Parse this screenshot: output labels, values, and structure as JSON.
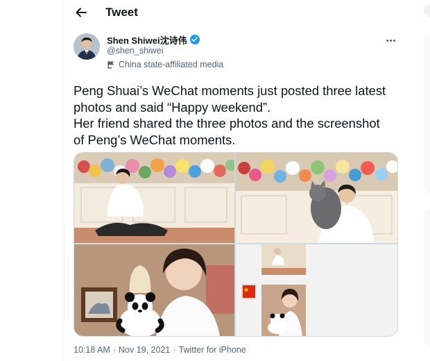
{
  "header": {
    "title": "Tweet",
    "back_icon": "arrow-left-icon"
  },
  "author": {
    "name": "Shen Shiwei沈诗伟",
    "handle": "@shen_shiwei",
    "verified": true,
    "affiliation": "China state-affiliated media",
    "affiliation_icon": "state-media-flag-icon"
  },
  "tweet": {
    "lines": [
      "Peng Shuai’s WeChat moments just posted three latest",
      "photos and said “Happy weekend”.",
      "Her friend shared the three photos and the screenshot",
      "of Peng’s WeChat moments."
    ]
  },
  "media": {
    "images": [
      "photo-woman-sitting-floor",
      "photo-woman-holding-cat",
      "photo-selfie-with-panda-doll",
      "photo-wechat-moments-screenshot"
    ]
  },
  "meta": {
    "time": "10:18 AM",
    "separator": "·",
    "date": "Nov 19, 2021",
    "source": "Twitter for iPhone"
  },
  "colors": {
    "accent": "#1d9bf0",
    "secondary_text": "#536471",
    "border": "#cfd9de"
  }
}
